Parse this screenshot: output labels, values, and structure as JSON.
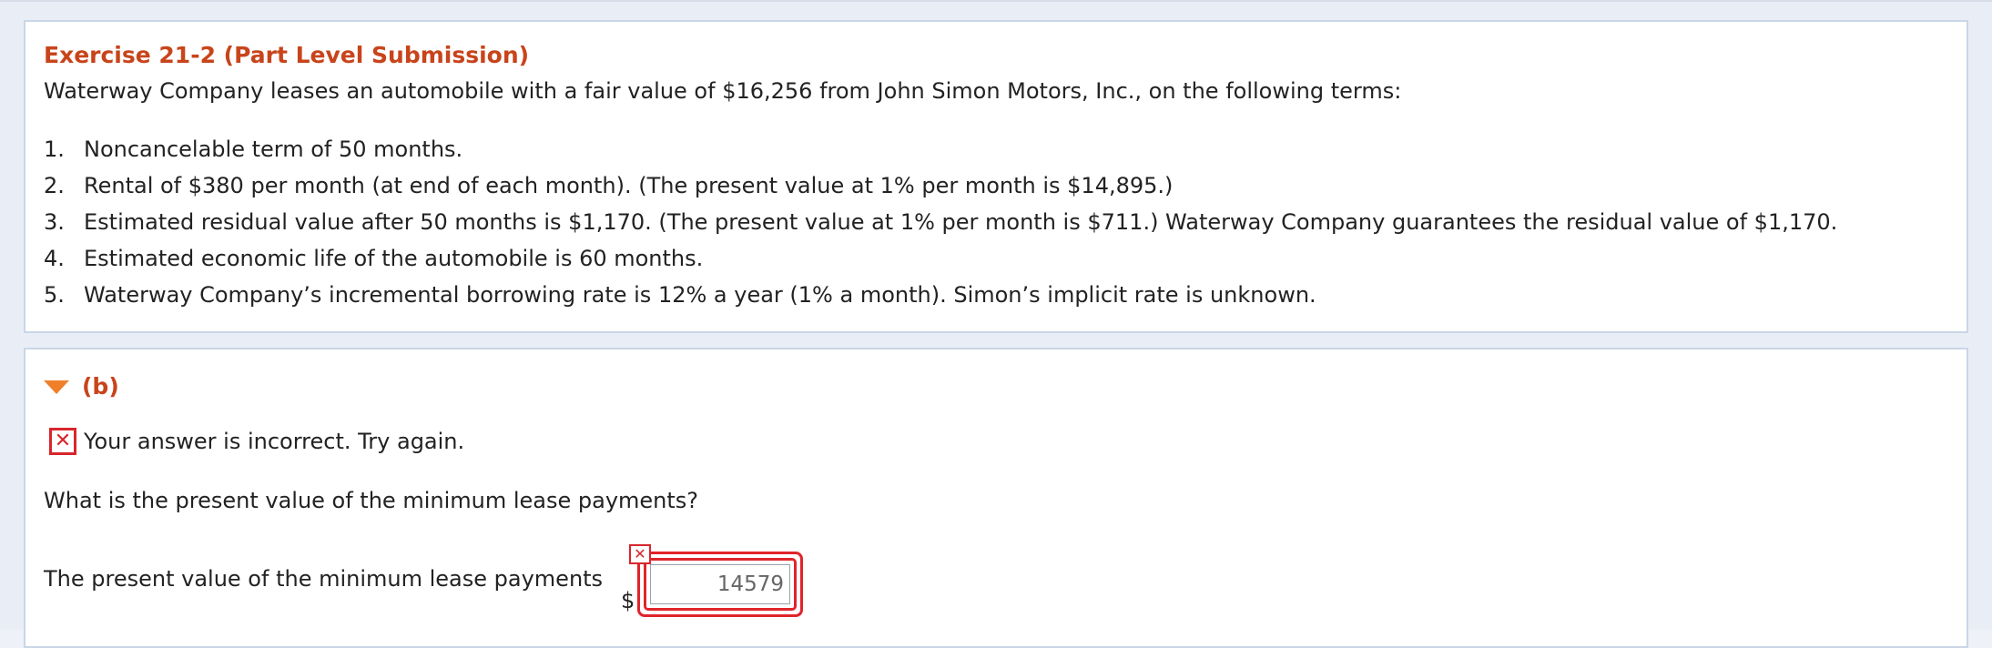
{
  "exercise": {
    "title": "Exercise 21-2 (Part Level Submission)",
    "intro": "Waterway Company leases an automobile with a fair value of $16,256 from John Simon Motors, Inc., on the following terms:",
    "terms": [
      {
        "num": "1.",
        "text": "Noncancelable term of 50 months."
      },
      {
        "num": "2.",
        "text": "Rental of $380 per month (at end of each month). (The present value at 1% per month is $14,895.)"
      },
      {
        "num": "3.",
        "text": "Estimated residual value after 50 months is $1,170. (The present value at 1% per month is $711.) Waterway Company guarantees the residual value of $1,170."
      },
      {
        "num": "4.",
        "text": "Estimated economic life of the automobile is 60 months."
      },
      {
        "num": "5.",
        "text": "Waterway Company’s incremental borrowing rate is 12% a year (1% a month). Simon’s implicit rate is unknown."
      }
    ]
  },
  "part": {
    "label": "(b)",
    "feedback_icon": "x-icon",
    "feedback": "Your answer is incorrect.  Try again.",
    "question": "What is the present value of the minimum lease payments?",
    "answer_label": "The present value of the minimum lease payments",
    "currency": "$",
    "answer_value": "14579",
    "answer_error_icon": "x-icon"
  },
  "colors": {
    "title": "#c8441b",
    "error": "#d8262c",
    "caret": "#f07f2a",
    "panel_border": "#c9d6e6"
  }
}
